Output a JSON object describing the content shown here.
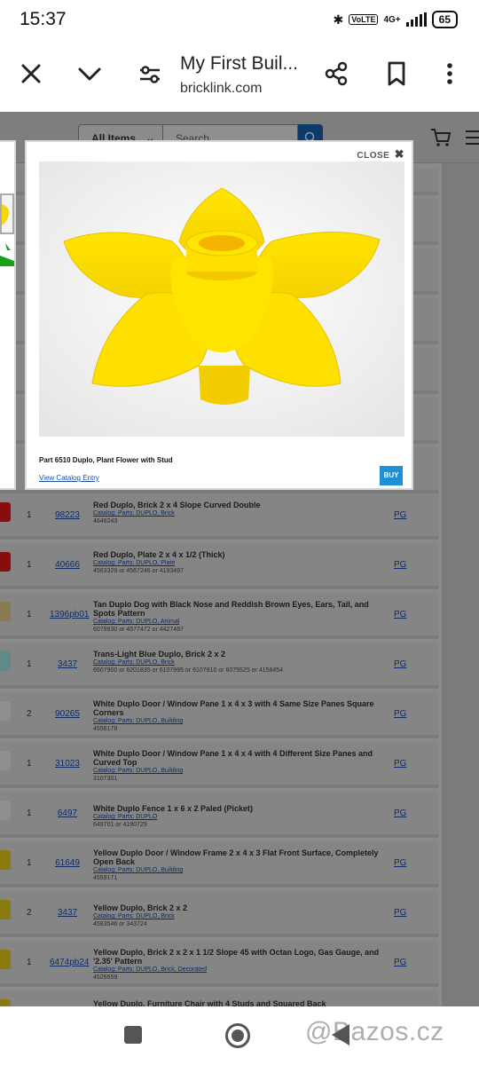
{
  "status_bar": {
    "time": "15:37",
    "network": "4G+",
    "volte": "VoLTE",
    "battery": "65"
  },
  "browser": {
    "title": "My First Buil...",
    "domain": "bricklink.com"
  },
  "site_header": {
    "category": "All Items",
    "search_placeholder": "Search..."
  },
  "lightbox": {
    "close_label": "CLOSE",
    "caption": "Part 6510 Duplo, Plant Flower with Stud",
    "catalog_link": "View Catalog Entry",
    "buy_label": "BUY"
  },
  "rows": [
    {
      "qty": "1",
      "item": "98223",
      "desc": "Red Duplo, Brick 2 x 4 Slope Curved Double",
      "cat": "Catalog: Parts: DUPLO, Brick",
      "alt": "4646243",
      "pg": "PG",
      "thumb_color": "#8a0d0d"
    },
    {
      "qty": "1",
      "item": "40666",
      "desc": "Red Duplo, Plate 2 x 4 x 1/2 (Thick)",
      "cat": "Catalog: Parts: DUPLO, Plate",
      "alt": "4563329 or 4567246 or 4193497",
      "pg": "PG",
      "thumb_color": "#8a0d0d"
    },
    {
      "qty": "1",
      "item": "1396pb01",
      "desc": "Tan Duplo Dog with Black Nose and Reddish Brown Eyes, Ears, Tail, and Spots Pattern",
      "cat": "Catalog: Parts: DUPLO, Animal",
      "alt": "6079830 or 4577472 or 4427467",
      "pg": "PG",
      "thumb_color": "#8a7a52"
    },
    {
      "qty": "1",
      "item": "3437",
      "desc": "Trans-Light Blue Duplo, Brick 2 x 2",
      "cat": "Catalog: Parts: DUPLO, Brick",
      "alt": "6507900 or 6201835 or 6107995 or 6107810 or 6075525 or 4158454",
      "pg": "PG",
      "thumb_color": "#5f8a8a"
    },
    {
      "qty": "2",
      "item": "90265",
      "desc": "White Duplo Door / Window Pane 1 x 4 x 3 with 4 Same Size Panes Square Corners",
      "cat": "Catalog: Parts: DUPLO, Building",
      "alt": "4556178",
      "pg": "PG",
      "thumb_color": "#8f8f8f"
    },
    {
      "qty": "1",
      "item": "31023",
      "desc": "White Duplo Door / Window Pane 1 x 4 x 4 with 4 Different Size Panes and Curved Top",
      "cat": "Catalog: Parts: DUPLO, Building",
      "alt": "3107301",
      "pg": "PG",
      "thumb_color": "#8f8f8f"
    },
    {
      "qty": "1",
      "item": "6497",
      "desc": "White Duplo Fence 1 x 6 x 2 Paled (Picket)",
      "cat": "Catalog: Parts: DUPLO",
      "alt": "649701 or 4190729",
      "pg": "PG",
      "thumb_color": "#8f8f8f"
    },
    {
      "qty": "1",
      "item": "61649",
      "desc": "Yellow Duplo Door / Window Frame 2 x 4 x 3 Flat Front Surface, Completely Open Back",
      "cat": "Catalog: Parts: DUPLO, Building",
      "alt": "4559171",
      "pg": "PG",
      "thumb_color": "#8a7a10"
    },
    {
      "qty": "2",
      "item": "3437",
      "desc": "Yellow Duplo, Brick 2 x 2",
      "cat": "Catalog: Parts: DUPLO, Brick",
      "alt": "4583546 or 343724",
      "pg": "PG",
      "thumb_color": "#8a7a10"
    },
    {
      "qty": "1",
      "item": "6474pb24",
      "desc": "Yellow Duplo, Brick 2 x 2 x 1 1/2 Slope 45 with Octan Logo, Gas Gauge, and '2.35' Pattern",
      "cat": "Catalog: Parts: DUPLO, Brick, Decorated",
      "alt": "4526659",
      "pg": "PG",
      "thumb_color": "#8a7a10"
    },
    {
      "qty": "",
      "item": "",
      "desc": "Yellow Duplo, Furniture Chair with 4 Studs and Squared Back",
      "cat": "",
      "alt": "",
      "pg": "",
      "thumb_color": "#8a7a10"
    }
  ],
  "nav": {
    "watermark": "@Bazos.cz"
  }
}
